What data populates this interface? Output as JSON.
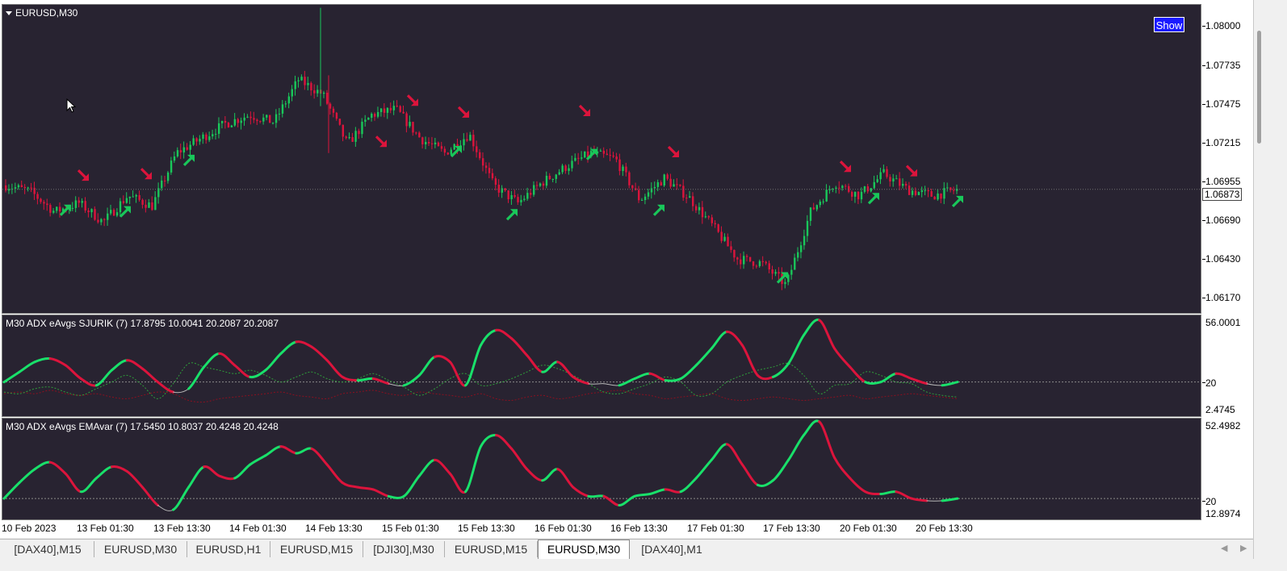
{
  "window": {
    "symbol_label": "EURUSD,M30",
    "show_button": "Show"
  },
  "price_axis": {
    "labels": [
      "1.08000",
      "1.07735",
      "1.07475",
      "1.07215",
      "1.06955",
      "1.06690",
      "1.06430",
      "1.06170"
    ],
    "current": "1.06873",
    "min": 1.0602,
    "max": 1.0813
  },
  "indicator1": {
    "title": "M30  ADX eAvgs  SJURIK (7) 17.8795 10.0041 20.2087 20.2087",
    "scale_top": "56.0001",
    "level": "20",
    "scale_bottom": "2.4745",
    "min": 2.4745,
    "max": 56.0001
  },
  "indicator2": {
    "title": "M30  ADX eAvgs EMAvar (7) 17.5450 10.8037 20.4248 20.4248",
    "scale_top": "52.4982",
    "level": "20",
    "scale_bottom": "12.8974",
    "min": 12.8974,
    "max": 52.4982
  },
  "time_axis": [
    "10 Feb 2023",
    "13 Feb 01:30",
    "13 Feb 13:30",
    "14 Feb 01:30",
    "14 Feb 13:30",
    "15 Feb 01:30",
    "15 Feb 13:30",
    "16 Feb 01:30",
    "16 Feb 13:30",
    "17 Feb 01:30",
    "17 Feb 13:30",
    "20 Feb 01:30",
    "20 Feb 13:30"
  ],
  "tabs": [
    "[DAX40],M15",
    "EURUSD,M30",
    "EURUSD,H1",
    "EURUSD,M15",
    "[DJI30],M30",
    "EURUSD,M15",
    "EURUSD,M30",
    "[DAX40],M1"
  ],
  "active_tab": 6,
  "colors": {
    "background": "#282331",
    "bull": "#19c75a",
    "bear": "#dc143c",
    "adx_up": "#19e06a",
    "adx_down": "#dc143c",
    "plus_di": "#2f9e3a",
    "minus_di": "#8b1020"
  },
  "icons": {
    "tab_prev": "triangle-left-icon",
    "tab_next": "triangle-right-icon",
    "arrow_up": "arrow-up-right-icon",
    "arrow_down": "arrow-down-right-icon"
  },
  "chart_data": [
    {
      "type": "candlestick",
      "title": "EURUSD,M30",
      "ylim": [
        1.0602,
        1.0813
      ],
      "close_path": [
        {
          "x": "10 Feb 2023",
          "y": 1.069
        },
        {
          "x": "10 Feb",
          "y": 1.0686
        },
        {
          "x": "10 Feb",
          "y": 1.0672
        },
        {
          "x": "13 Feb 01:30",
          "y": 1.0678
        },
        {
          "x": "13 Feb",
          "y": 1.0665
        },
        {
          "x": "13 Feb",
          "y": 1.0683
        },
        {
          "x": "13 Feb",
          "y": 1.0676
        },
        {
          "x": "13 Feb 13:30",
          "y": 1.0712
        },
        {
          "x": "13 Feb",
          "y": 1.0722
        },
        {
          "x": "14 Feb 01:30",
          "y": 1.0732
        },
        {
          "x": "14 Feb",
          "y": 1.0738
        },
        {
          "x": "14 Feb",
          "y": 1.0733
        },
        {
          "x": "14 Feb",
          "y": 1.0762
        },
        {
          "x": "14 Feb 13:30",
          "y": 1.0752
        },
        {
          "x": "14 Feb",
          "y": 1.0718
        },
        {
          "x": "14 Feb",
          "y": 1.0738
        },
        {
          "x": "15 Feb 01:30",
          "y": 1.0742
        },
        {
          "x": "15 Feb",
          "y": 1.0722
        },
        {
          "x": "15 Feb",
          "y": 1.0712
        },
        {
          "x": "15 Feb",
          "y": 1.0725
        },
        {
          "x": "15 Feb 13:30",
          "y": 1.069
        },
        {
          "x": "15 Feb",
          "y": 1.0678
        },
        {
          "x": "16 Feb 01:30",
          "y": 1.0692
        },
        {
          "x": "16 Feb",
          "y": 1.0703
        },
        {
          "x": "16 Feb",
          "y": 1.0712
        },
        {
          "x": "16 Feb",
          "y": 1.0708
        },
        {
          "x": "16 Feb 13:30",
          "y": 1.068
        },
        {
          "x": "16 Feb",
          "y": 1.0695
        },
        {
          "x": "17 Feb 01:30",
          "y": 1.0682
        },
        {
          "x": "17 Feb",
          "y": 1.0662
        },
        {
          "x": "17 Feb",
          "y": 1.064
        },
        {
          "x": "17 Feb",
          "y": 1.0637
        },
        {
          "x": "17 Feb 13:30",
          "y": 1.0622
        },
        {
          "x": "17 Feb",
          "y": 1.0672
        },
        {
          "x": "17 Feb",
          "y": 1.0692
        },
        {
          "x": "20 Feb 01:30",
          "y": 1.0683
        },
        {
          "x": "20 Feb",
          "y": 1.0698
        },
        {
          "x": "20 Feb",
          "y": 1.0687
        },
        {
          "x": "20 Feb 13:30",
          "y": 1.0683
        },
        {
          "x": "20 Feb",
          "y": 1.0687
        }
      ],
      "signals_down": [
        1.0697,
        1.0698,
        1.072,
        1.0748,
        1.074,
        1.0741,
        1.0713,
        1.0703,
        1.07,
        1.0701
      ],
      "signals_up": [
        1.0673,
        1.0672,
        1.0707,
        1.0713,
        1.067,
        1.0711,
        1.0673,
        1.0627,
        1.0681,
        1.0679
      ],
      "current_price": 1.06873
    },
    {
      "type": "line",
      "title": "M30  ADX eAvgs  SJURIK (7) 17.8795 10.0041 20.2087 20.2087",
      "ylim": [
        2.4745,
        56.0001
      ],
      "reference_level": 20,
      "series": [
        {
          "values": [
            20,
            26,
            32,
            34,
            30,
            22,
            18,
            27,
            33,
            28,
            20,
            14,
            16,
            29,
            37,
            30,
            23,
            27,
            37,
            44,
            41,
            33,
            23,
            21,
            22,
            19,
            18,
            24,
            35,
            32,
            18,
            42,
            51,
            46,
            36,
            26,
            32,
            23,
            19,
            19,
            18,
            22,
            25,
            21,
            22,
            30,
            40,
            50,
            42,
            24,
            23,
            31,
            48,
            57,
            40,
            29,
            20,
            20,
            25,
            22,
            19,
            18,
            20
          ]
        },
        {
          "values": [
            14,
            13,
            16,
            17,
            14,
            12,
            16,
            20,
            24,
            18,
            10,
            19,
            31,
            29,
            27,
            25,
            27,
            24,
            20,
            23,
            26,
            22,
            20,
            22,
            25,
            21,
            17,
            12,
            16,
            22,
            25,
            18,
            19,
            22,
            26,
            30,
            28,
            24,
            19,
            14,
            13,
            16,
            19,
            23,
            20,
            12,
            13,
            20,
            24,
            27,
            29,
            31,
            24,
            13,
            18,
            19,
            26,
            24,
            20,
            19,
            14,
            12,
            11
          ]
        },
        {
          "values": [
            13,
            14,
            13,
            15,
            13,
            12,
            13,
            11,
            10,
            12,
            14,
            13,
            9,
            8,
            10,
            11,
            12,
            13,
            14,
            12,
            11,
            10,
            13,
            14,
            15,
            13,
            12,
            14,
            13,
            12,
            11,
            13,
            10,
            9,
            11,
            12,
            10,
            11,
            13,
            14,
            15,
            13,
            12,
            10,
            11,
            12,
            13,
            10,
            9,
            10,
            11,
            10,
            9,
            10,
            11,
            12,
            10,
            11,
            12,
            13,
            12,
            11,
            10
          ]
        }
      ]
    },
    {
      "type": "line",
      "title": "M30  ADX eAvgs EMAvar (7) 17.5450 10.8037 20.4248 20.4248",
      "ylim": [
        12.8974,
        52.4982
      ],
      "reference_level": 20,
      "series": [
        {
          "values": [
            20,
            27,
            33,
            36,
            31,
            23,
            29,
            34,
            32,
            25,
            17,
            15,
            25,
            34,
            30,
            29,
            35,
            39,
            43,
            40,
            42,
            35,
            27,
            25,
            24,
            21,
            21,
            30,
            37,
            31,
            23,
            43,
            48,
            42,
            33,
            28,
            33,
            25,
            21,
            21,
            17,
            21,
            22,
            24,
            23,
            29,
            37,
            44,
            35,
            26,
            28,
            37,
            48,
            54,
            38,
            29,
            23,
            22,
            23,
            20,
            19,
            19,
            20
          ]
        }
      ]
    }
  ]
}
